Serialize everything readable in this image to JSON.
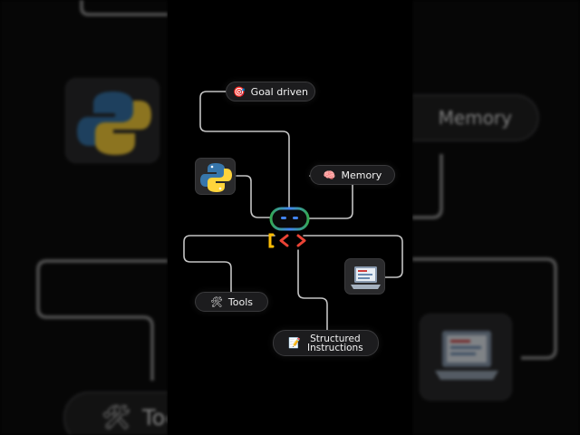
{
  "nodes": {
    "goal": {
      "label": "Goal driven",
      "icon": "target-icon"
    },
    "memory": {
      "label": "Memory",
      "icon": "brain-icon"
    },
    "tools": {
      "label": "Tools",
      "icon": "tools-icon"
    },
    "structured": {
      "label_line1": "Structured",
      "label_line2": "Instructions",
      "icon": "memo-icon"
    },
    "python": {
      "icon": "python-logo"
    },
    "laptop": {
      "icon": "laptop-icon"
    },
    "agent": {
      "icon": "robot-code-icon"
    }
  },
  "background": {
    "memory_label": "Memory",
    "tools_label_partial": "Too"
  },
  "colors": {
    "background": "#000000",
    "chip_fill": "#1c1c1e",
    "connector": "#bdbdbd",
    "brand_blue": "#4285F4",
    "brand_red": "#EA4335",
    "brand_yellow": "#FBBC05",
    "brand_green": "#34A853",
    "python_blue": "#3776AB",
    "python_yellow": "#FFD43B"
  }
}
